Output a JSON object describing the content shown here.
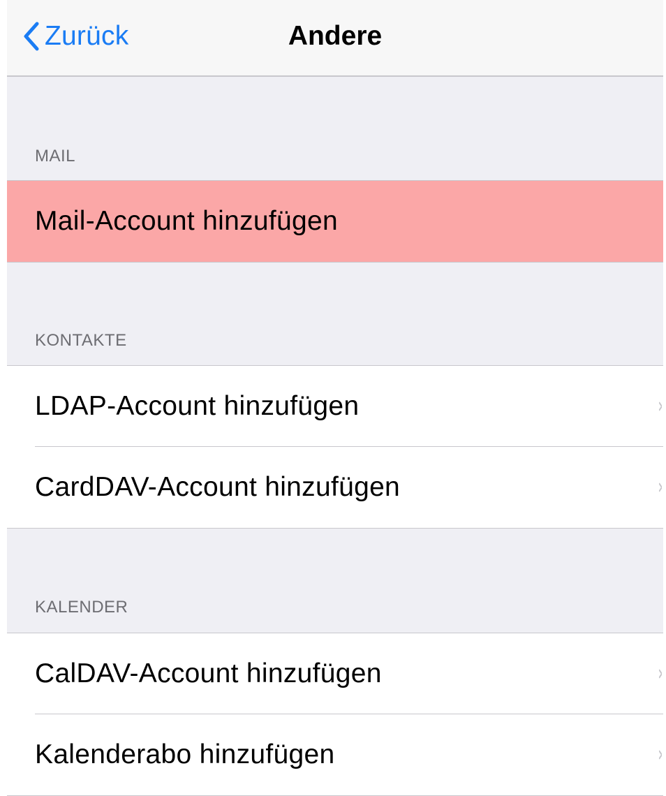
{
  "nav": {
    "back_label": "Zurück",
    "title": "Andere",
    "accent_color": "#1a7cf4"
  },
  "sections": [
    {
      "header": "MAIL",
      "rows": [
        {
          "label": "Mail-Account hinzufügen",
          "highlighted": true,
          "highlight_color": "#fba7a7"
        }
      ]
    },
    {
      "header": "KONTAKTE",
      "rows": [
        {
          "label": "LDAP-Account hinzufügen"
        },
        {
          "label": "CardDAV-Account hinzufügen"
        }
      ]
    },
    {
      "header": "KALENDER",
      "rows": [
        {
          "label": "CalDAV-Account hinzufügen"
        },
        {
          "label": "Kalenderabo hinzufügen"
        }
      ]
    }
  ],
  "icons": {
    "back": "chevron-left-icon",
    "disclosure": "chevron-right-icon"
  }
}
